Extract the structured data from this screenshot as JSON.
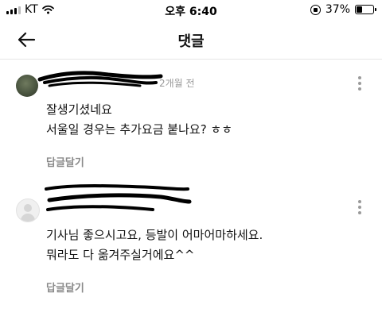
{
  "status_bar": {
    "carrier": "KT",
    "time": "오후 6:40",
    "battery": "37%",
    "battery_level": 0.37
  },
  "header": {
    "title": "댓글"
  },
  "comments": [
    {
      "time_ago": "2개월 전",
      "text_lines": [
        "잘생기셨네요",
        "서울일 경우는 추가요금 붙나요? ㅎㅎ"
      ],
      "reply_label": "답글달기",
      "author_redacted": true
    },
    {
      "time_ago": "",
      "text_lines": [
        "기사님 좋으시고요, 등발이 어마어마하세요.",
        "뭐라도 다 옮겨주실거에요^^"
      ],
      "reply_label": "답글달기",
      "author_redacted": true
    }
  ]
}
